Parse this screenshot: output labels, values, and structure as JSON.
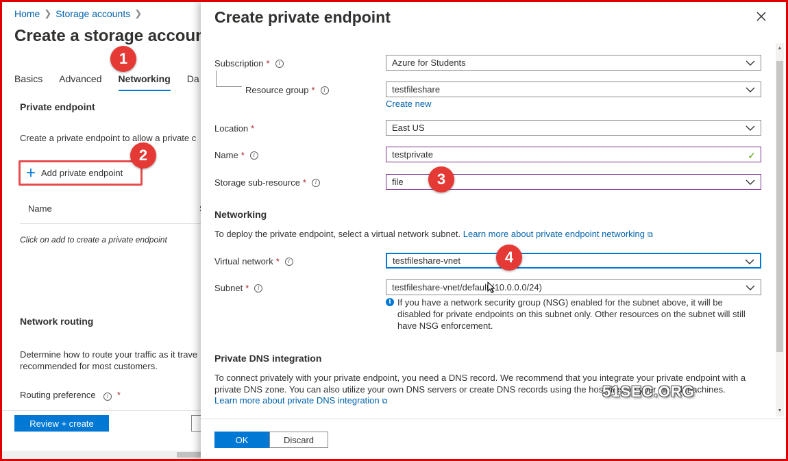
{
  "breadcrumb": {
    "home": "Home",
    "storage_accounts": "Storage accounts"
  },
  "left_page": {
    "title": "Create a storage account",
    "tabs": [
      {
        "label": "Basics"
      },
      {
        "label": "Advanced"
      },
      {
        "label": "Networking"
      },
      {
        "label": "Da"
      }
    ],
    "private_endpoint_heading": "Private endpoint",
    "private_endpoint_desc": "Create a private endpoint to allow a private c",
    "add_button_label": "Add private endpoint",
    "list_header_name": "Name",
    "list_header_second": "S",
    "empty_message": "Click on add to create a private endpoint",
    "network_routing_heading": "Network routing",
    "network_routing_desc_1": "Determine how to route your traffic as it trave",
    "network_routing_desc_2": "recommended for most customers.",
    "routing_preference_label": "Routing preference",
    "review_button": "Review + create"
  },
  "callouts": {
    "c1": "1",
    "c2": "2",
    "c3": "3",
    "c4": "4"
  },
  "blade": {
    "title": "Create private endpoint",
    "subscription": {
      "label": "Subscription",
      "value": "Azure for Students"
    },
    "resource_group": {
      "label": "Resource group",
      "value": "testfileshare",
      "create_new": "Create new"
    },
    "location": {
      "label": "Location",
      "value": "East US"
    },
    "name": {
      "label": "Name",
      "value": "testprivate"
    },
    "sub_resource": {
      "label": "Storage sub-resource",
      "value": "file"
    },
    "networking": {
      "heading": "Networking",
      "desc": "To deploy the private endpoint, select a virtual network subnet.",
      "learn_more": "Learn more about private endpoint networking"
    },
    "virtual_network": {
      "label": "Virtual network",
      "value": "testfileshare-vnet"
    },
    "subnet": {
      "label": "Subnet",
      "value": "testfileshare-vnet/default (10.0.0.0/24)",
      "note_1": "If you have a network security group (NSG) enabled for the subnet above, it will be",
      "note_2": "disabled for private endpoints on this subnet only. Other resources on the subnet will still",
      "note_3": "have NSG enforcement."
    },
    "dns": {
      "heading": "Private DNS integration",
      "desc_1": "To connect privately with your private endpoint, you need a DNS record. We recommend that you integrate your private endpoint with a",
      "desc_2": "private DNS zone. You can also utilize your own DNS servers or create DNS records using the host files on your virtual machines.",
      "learn_more": "Learn more about private DNS integration"
    },
    "ok_button": "OK",
    "discard_button": "Discard"
  },
  "watermark": "51SEC.ORG",
  "colors": {
    "accent": "#0078d4",
    "callout": "#e53935",
    "frame": "#e00000",
    "required": "#a4262c"
  }
}
